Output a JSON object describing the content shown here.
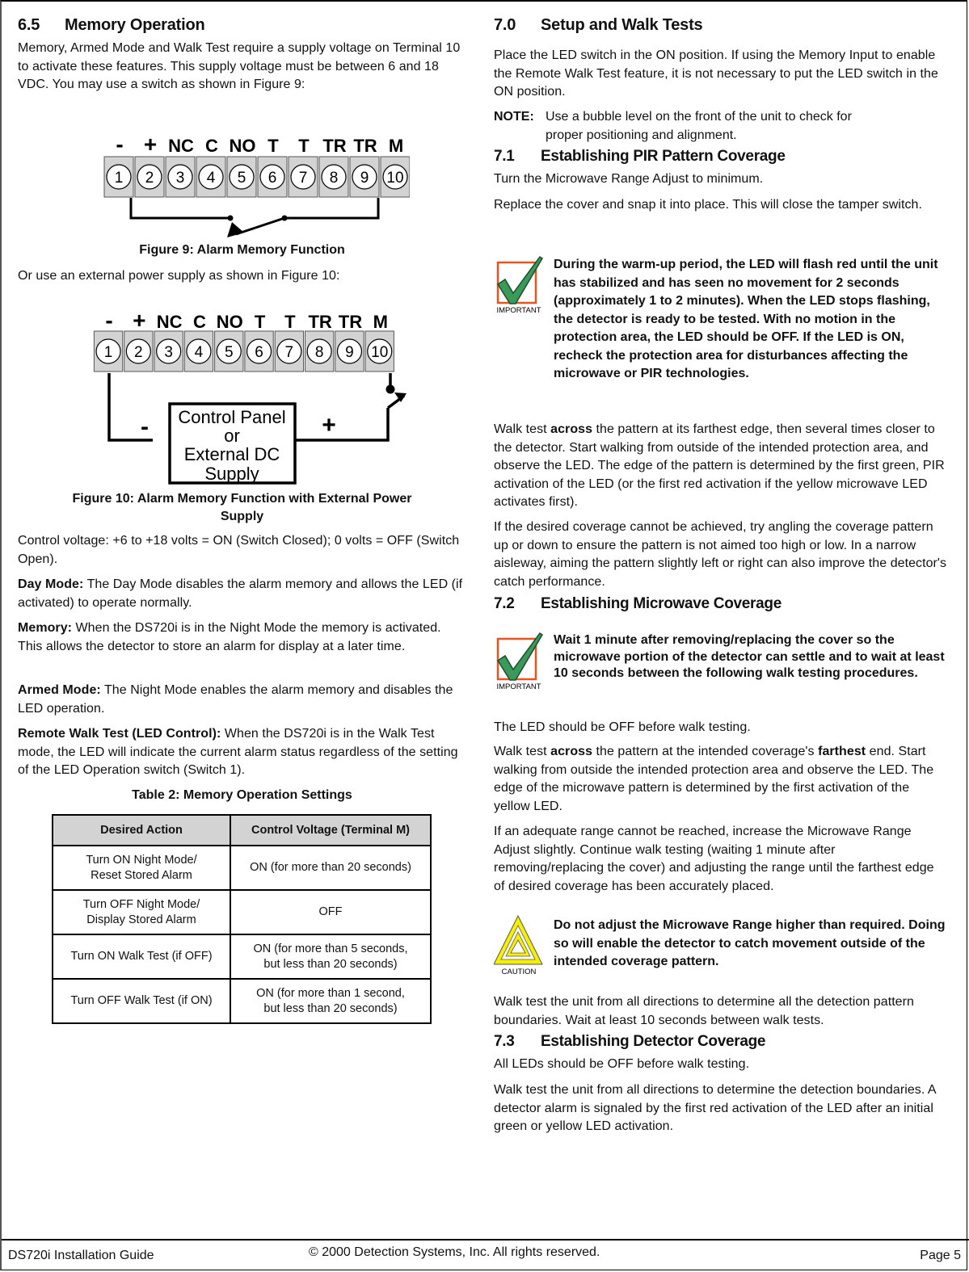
{
  "left": {
    "section_6_5": {
      "number": "6.5",
      "title": "Memory Operation",
      "intro": "Memory, Armed Mode and Walk Test require a supply voltage on Terminal 10 to activate these features. This supply voltage must be between 6 and 18 VDC. You may use a switch as shown in Figure 9:"
    },
    "terminal_labels": [
      "-",
      "+",
      "NC",
      "C",
      "NO",
      "T",
      "T",
      "TR",
      "TR",
      "M"
    ],
    "terminal_numbers": [
      "1",
      "2",
      "3",
      "4",
      "5",
      "6",
      "7",
      "8",
      "9",
      "10"
    ],
    "figure9_caption": "Figure 9: Alarm Memory Function",
    "figure10_intro": "Or use an external power supply as shown in Figure 10:",
    "figure10": {
      "box_lines": [
        "Control Panel",
        "or",
        "External DC",
        "Supply"
      ],
      "minus": "-",
      "plus": "+"
    },
    "figure10_caption_line1": "Figure 10: Alarm Memory Function with External Power",
    "figure10_caption_line2": "Supply",
    "control_voltage": "Control voltage: +6 to +18 volts = ON (Switch Closed); 0 volts = OFF (Switch Open).",
    "day_mode": {
      "label": "Day Mode:",
      "text": " The Day Mode disables the alarm memory and allows the LED (if activated) to operate normally."
    },
    "memory": {
      "label": "Memory:",
      "text": " When the DS720i is in the Night Mode the memory is activated. This allows the detector to store an alarm for display at a later time."
    },
    "armed_mode": {
      "label": "Armed Mode:",
      "text": " The Night Mode enables the alarm memory and disables the LED operation."
    },
    "remote_walk": {
      "label": "Remote Walk Test (LED Control):",
      "text": " When the DS720i is in the Walk Test mode, the LED will indicate the current alarm status regardless of the setting of the LED Operation switch (Switch 1)."
    },
    "table2": {
      "caption": "Table 2: Memory Operation Settings",
      "headers": [
        "Desired Action",
        "Control Voltage (Terminal M)"
      ],
      "rows": [
        {
          "action_l1": "Turn ON Night Mode/",
          "action_l2": "Reset Stored Alarm",
          "voltage_l1": "ON (for more than 20 seconds)",
          "voltage_l2": ""
        },
        {
          "action_l1": "Turn OFF Night Mode/",
          "action_l2": "Display Stored Alarm",
          "voltage_l1": "OFF",
          "voltage_l2": ""
        },
        {
          "action_l1": "Turn ON Walk Test (if OFF)",
          "action_l2": "",
          "voltage_l1": "ON (for more than 5 seconds,",
          "voltage_l2": "but less than 20 seconds)"
        },
        {
          "action_l1": "Turn OFF Walk Test (if ON)",
          "action_l2": "",
          "voltage_l1": "ON (for more than 1 second,",
          "voltage_l2": "but less than 20 seconds)"
        }
      ]
    }
  },
  "right": {
    "section_7_0": {
      "number": "7.0",
      "title": "Setup and Walk Tests",
      "text": "Place the LED switch in the ON position. If using the Memory Input to enable the Remote Walk Test feature, it is not necessary to put the LED switch in the ON position.",
      "note_label": "NOTE:",
      "note_line1": "Use a bubble level on the front of the unit to check for",
      "note_line2": "proper positioning and alignment."
    },
    "section_7_1": {
      "number": "7.1",
      "title": "Establishing PIR Pattern Coverage",
      "p1": "Turn the Microwave Range Adjust to minimum.",
      "p2": "Replace the cover and snap it into place. This will close the tamper switch.",
      "important_label": "IMPORTANT",
      "important_text": "During the warm-up period, the LED will flash red until the unit has stabilized and has seen no movement for 2 seconds (approximately 1 to 2 minutes).  When the LED stops flashing, the detector is ready to be tested. With no motion in the protection area, the LED should be OFF. If the LED is ON, recheck the protection area for disturbances affecting the microwave or PIR technologies.",
      "p3_pre": "Walk test ",
      "p3_bold": "across",
      "p3_post": " the pattern at its farthest edge, then several times closer to the detector.  Start walking from outside of the intended protection area, and observe the LED.  The edge of the pattern is determined by the first green, PIR activation of the LED (or the first red activation if the yellow microwave LED activates first).",
      "p4": "If the desired coverage cannot be achieved, try angling the coverage pattern up or down to ensure the pattern is not aimed too high or low. In a narrow aisleway, aiming the pattern slightly left or right can also improve the detector's catch performance."
    },
    "section_7_2": {
      "number": "7.2",
      "title": "Establishing Microwave Coverage",
      "important_label": "IMPORTANT",
      "important_text": "Wait 1 minute after removing/replacing the cover so the microwave portion of the detector can settle and to wait at least 10 seconds between the following walk testing procedures.",
      "p1": "The LED should be OFF before walk testing.",
      "p2_a": "Walk test ",
      "p2_b": "across",
      "p2_c": " the pattern at the intended coverage's ",
      "p2_d": "farthest",
      "p2_e": " end.  Start walking from outside the intended protection area and observe the LED.  The edge of the microwave pattern is determined by the first activation of the yellow LED.",
      "p3": "If an adequate range cannot be reached, increase the Microwave Range Adjust slightly.  Continue walk testing (waiting 1 minute after removing/replacing the cover) and adjusting the range until the farthest edge of desired coverage has been accurately placed.",
      "caution_label": "CAUTION",
      "caution_text": "Do not adjust the Microwave Range higher than required.  Doing so will enable the detector to catch movement outside of the intended coverage pattern.",
      "p4": "Walk test the unit from all directions to determine all the detection pattern boundaries.  Wait at least 10 seconds between walk tests."
    },
    "section_7_3": {
      "number": "7.3",
      "title": "Establishing Detector Coverage",
      "p1": "All LEDs should be OFF before walk testing.",
      "p2": "Walk test the unit from all directions to determine the detection boundaries.  A detector alarm is signaled by the first red activation of the LED after an initial green or yellow LED activation."
    }
  },
  "footer": {
    "left": "DS720i Installation Guide",
    "center": "© 2000 Detection Systems, Inc. All rights reserved.",
    "right": "Page 5"
  },
  "colors": {
    "important_box": "#e8541e",
    "check_green": "#3a9a5a",
    "caution_yellow": "#f5f000",
    "table_header_bg": "#d3d3d3",
    "terminal_bg": "#d3d3d3"
  }
}
